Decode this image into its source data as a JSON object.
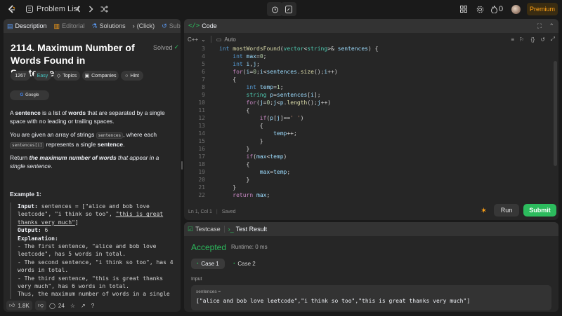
{
  "topbar": {
    "problem_list": "Problem List",
    "streak_count": "0",
    "premium": "Premium"
  },
  "desc_tabs": [
    {
      "label": "Description"
    },
    {
      "label": "Editorial"
    },
    {
      "label": "Solutions"
    },
    {
      "label": "(Click)"
    },
    {
      "label": "Submi"
    }
  ],
  "problem": {
    "title": "2114. Maximum Number of Words Found in Sentences",
    "solved": "Solved",
    "count": "1267",
    "difficulty": "Easy",
    "topics": "Topics",
    "companies": "Companies",
    "hint": "Hint",
    "company_tag": "Google",
    "p1_a": "A ",
    "p1_b": "sentence",
    "p1_c": " is a list of ",
    "p1_d": "words",
    "p1_e": " that are separated by a single space with no leading or trailing spaces.",
    "p2_a": "You are given an array of strings ",
    "p2_code1": "sentences",
    "p2_b": ", where each ",
    "p2_code2": "sentences[i]",
    "p2_c": " represents a single ",
    "p2_d": "sentence",
    "p2_e": ".",
    "p3_a": "Return ",
    "p3_b": "the maximum number of words",
    "p3_c": " that appear in a single sentence",
    "p3_d": ".",
    "example_title": "Example 1:",
    "ex_input_label": "Input:",
    "ex_input_1": " sentences = [\"alice and bob love",
    "ex_input_2": "leetcode\", \"i think so too\", ",
    "ex_input_3": "\"this is great",
    "ex_input_4": "thanks very much\"",
    "ex_input_5": "]",
    "ex_output_label": "Output:",
    "ex_output": " 6",
    "ex_expl_label": "Explanation:",
    "ex_lines": [
      "- The first sentence, \"alice and bob love",
      "leetcode\", has 5 words in total.",
      "- The second sentence, \"i think so too\", has 4",
      "words in total.",
      "- The third sentence, \"this is great thanks",
      "very much\", has 6 words in total.",
      "Thus, the maximum number of words in a single"
    ]
  },
  "desc_footer": {
    "likes": "1.8K",
    "comments": "24"
  },
  "code_panel": {
    "title": "Code",
    "language": "C++",
    "autosave": "Auto",
    "status_pos": "Ln 1, Col 1",
    "status_saved": "Saved",
    "run": "Run",
    "submit": "Submit",
    "line_numbers": [
      "3",
      "4",
      "5",
      "6",
      "7",
      "8",
      "9",
      "10",
      "11",
      "12",
      "13",
      "14",
      "15",
      "16",
      "17",
      "18",
      "19",
      "20",
      "21",
      "22"
    ]
  },
  "test_panel": {
    "tab_testcase": "Testcase",
    "tab_result": "Test Result",
    "accepted": "Accepted",
    "runtime": "Runtime: 0 ms",
    "case1": "Case 1",
    "case2": "Case 2",
    "input_label": "Input",
    "input_var": "sentences =",
    "input_value": "[\"alice and bob love leetcode\",\"i think so too\",\"this is great thanks very much\"]"
  },
  "colors": {
    "accent_green": "#2cbb5d",
    "easy": "#46c6c2",
    "premium": "#ffa116"
  }
}
